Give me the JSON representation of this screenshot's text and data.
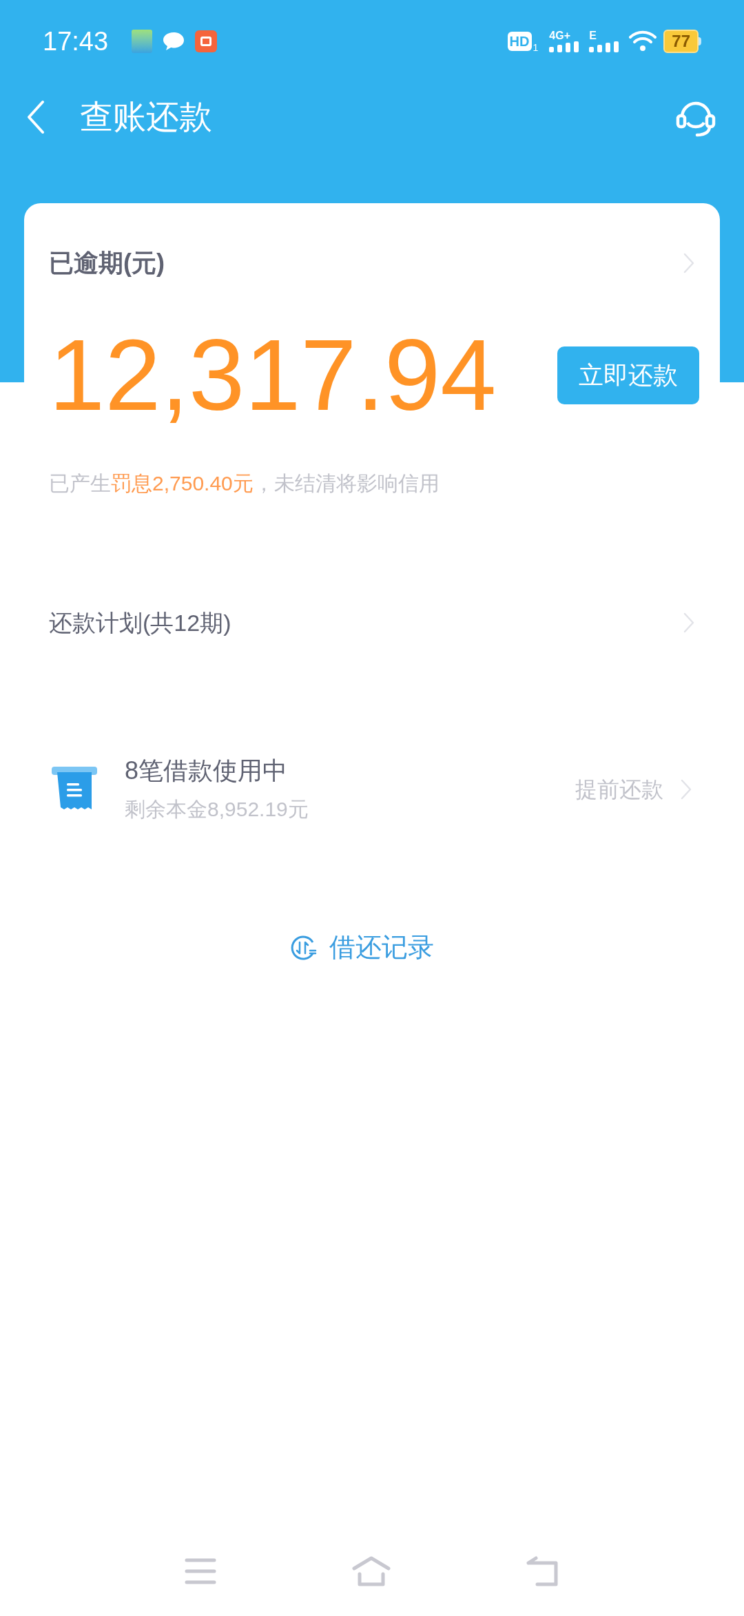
{
  "status_bar": {
    "time": "17:43",
    "hd": "HD",
    "hd_slot": "1",
    "network_1": "4G+",
    "network_2": "E",
    "battery": "77"
  },
  "header": {
    "title": "查账还款"
  },
  "overdue_card": {
    "label": "已逾期(元)",
    "amount": "12,317.94",
    "pay_button": "立即还款",
    "note": [
      {
        "text": "已产生",
        "highlight": false
      },
      {
        "text": "罚息2,750.40元",
        "highlight": true
      },
      {
        "text": "，未结清将影响信用",
        "highlight": false
      }
    ]
  },
  "plan_row": {
    "label": "还款计划(共12期)"
  },
  "loans_row": {
    "title": "8笔借款使用中",
    "subtitle": "剩余本金8,952.19元",
    "action": "提前还款"
  },
  "records_link": {
    "label": "借还记录"
  }
}
